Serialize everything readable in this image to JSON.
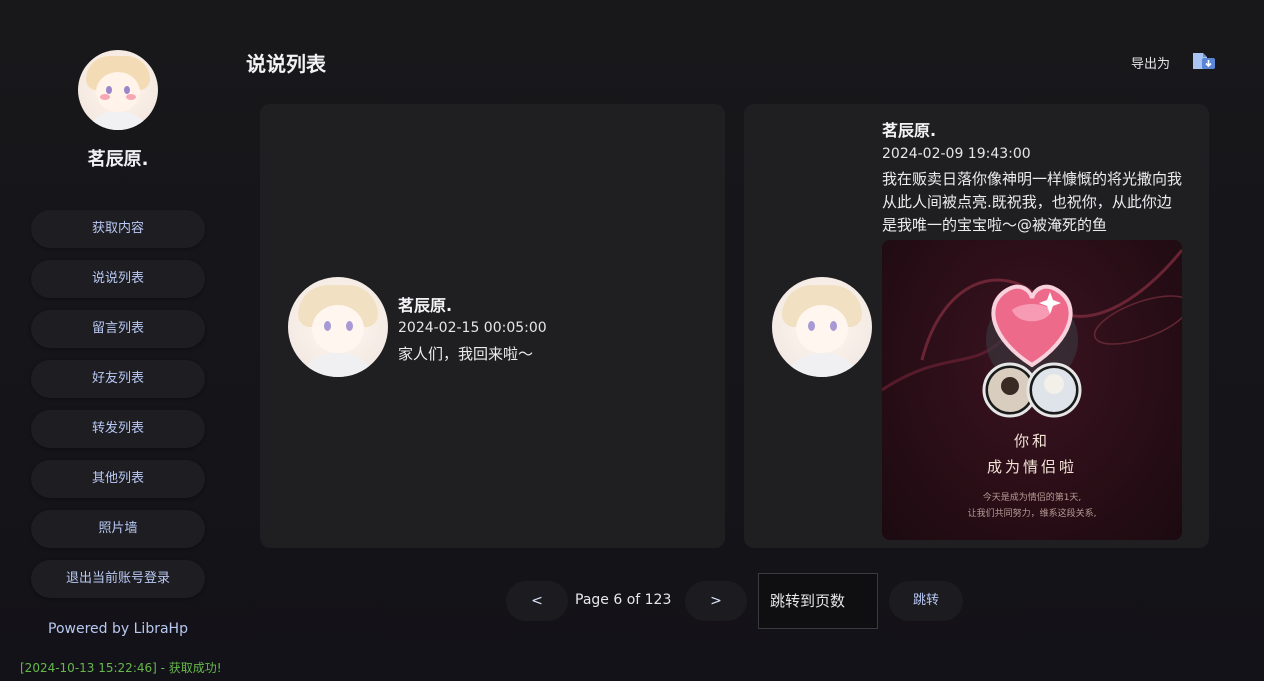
{
  "profile": {
    "name": "茗辰原."
  },
  "sidebar": {
    "items": [
      {
        "label": "获取内容"
      },
      {
        "label": "说说列表"
      },
      {
        "label": "留言列表"
      },
      {
        "label": "好友列表"
      },
      {
        "label": "转发列表"
      },
      {
        "label": "其他列表"
      },
      {
        "label": "照片墙"
      },
      {
        "label": "退出当前账号登录"
      }
    ],
    "powered": "Powered by LibraHp",
    "log": "[2024-10-13 15:22:46] - 获取成功!"
  },
  "header": {
    "title": "说说列表",
    "export_label": "导出为",
    "export_icon": "export-file-icon"
  },
  "posts": [
    {
      "name": "茗辰原.",
      "time": "2024-02-15 00:05:00",
      "text": "家人们，我回来啦～"
    },
    {
      "name": "茗辰原.",
      "time": "2024-02-09 19:43:00",
      "text": "我在贩卖日落你像神明一样慷慨的将光撒向我从此人间被点亮.既祝我，也祝你，从此你边是我唯一的宝宝啦～@被淹死的鱼",
      "image": {
        "line1": "你和",
        "line2": "成为情侣啦",
        "sub1": "今天是成为情侣的第1天,",
        "sub2": "让我们共同努力，维系这段关系,"
      }
    }
  ],
  "pagination": {
    "prev": "<",
    "next": ">",
    "info": "Page 6 of 123",
    "jump_placeholder": "跳转到页数",
    "jump_label": "跳转"
  },
  "colors": {
    "accent": "#b9c9f5",
    "log": "#66b84a",
    "background": "#16161a"
  }
}
